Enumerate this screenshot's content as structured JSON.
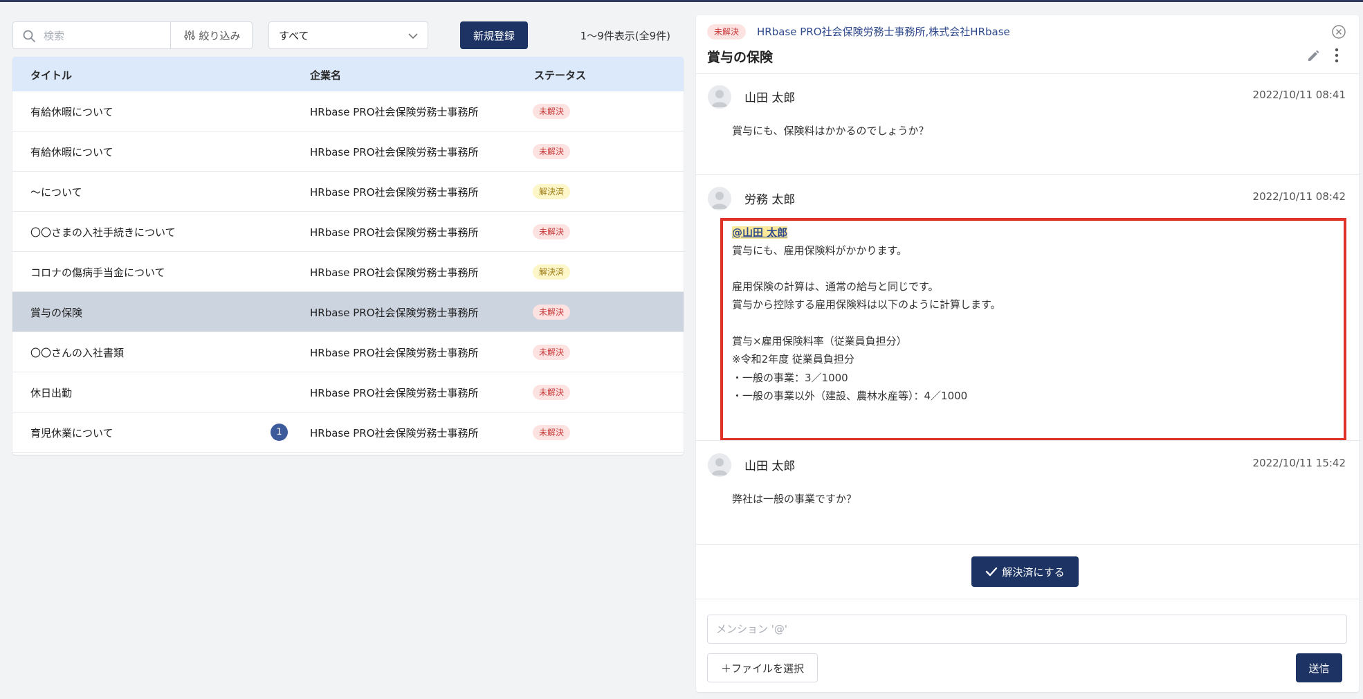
{
  "toolbar": {
    "search_placeholder": "検索",
    "filter_label": "絞り込み",
    "select_value": "すべて",
    "new_button": "新規登録",
    "count": "1～9件表示(全9件)"
  },
  "table": {
    "headers": {
      "title": "タイトル",
      "company": "企業名",
      "status": "ステータス"
    },
    "rows": [
      {
        "title": "有給休暇について",
        "company": "HRbase PRO社会保険労務士事務所",
        "status": "未解決",
        "kind": "unresolved"
      },
      {
        "title": "有給休暇について",
        "company": "HRbase PRO社会保険労務士事務所",
        "status": "未解決",
        "kind": "unresolved"
      },
      {
        "title": "〜について",
        "company": "HRbase PRO社会保険労務士事務所",
        "status": "解決済",
        "kind": "resolved"
      },
      {
        "title": "〇〇さまの入社手続きについて",
        "company": "HRbase PRO社会保険労務士事務所",
        "status": "未解決",
        "kind": "unresolved"
      },
      {
        "title": "コロナの傷病手当金について",
        "company": "HRbase PRO社会保険労務士事務所",
        "status": "解決済",
        "kind": "resolved"
      },
      {
        "title": "賞与の保険",
        "company": "HRbase PRO社会保険労務士事務所",
        "status": "未解決",
        "kind": "unresolved",
        "selected": true
      },
      {
        "title": "〇〇さんの入社書類",
        "company": "HRbase PRO社会保険労務士事務所",
        "status": "未解決",
        "kind": "unresolved"
      },
      {
        "title": "休日出勤",
        "company": "HRbase PRO社会保険労務士事務所",
        "status": "未解決",
        "kind": "unresolved"
      },
      {
        "title": "育児休業について",
        "company": "HRbase PRO社会保険労務士事務所",
        "status": "未解決",
        "kind": "unresolved",
        "unread": "1"
      }
    ]
  },
  "panel": {
    "status": "未解決",
    "company_1": "HRbase PRO社会保険労務士事務所",
    "separator": ",",
    "company_2": "株式会社HRbase",
    "title": "賞与の保険",
    "messages": [
      {
        "author": "山田 太郎",
        "time": "2022/10/11 08:41",
        "lines": [
          "賞与にも、保険料はかかるのでしょうか？"
        ]
      },
      {
        "author": "労務 太郎",
        "time": "2022/10/11 08:42",
        "mention": "@山田 太郎",
        "lines": [
          "賞与にも、雇用保険料がかかります。",
          "",
          "雇用保険の計算は、通常の給与と同じです。",
          "賞与から控除する雇用保険料は以下のように計算します。",
          "",
          "賞与×雇用保険料率（従業員負担分）",
          "※令和2年度 従業員負担分",
          "・一般の事業：3／1000",
          "・一般の事業以外（建設、農林水産等）：4／1000"
        ]
      },
      {
        "author": "山田 太郎",
        "time": "2022/10/11 15:42",
        "lines": [
          "弊社は一般の事業ですか？"
        ]
      }
    ],
    "resolve_button": "解決済にする",
    "mention_placeholder": "メンション '@'",
    "file_button": "＋ファイルを選択",
    "send_button": "送信"
  },
  "colors": {
    "primary": "#1c3363",
    "header_bg": "#dce9fa",
    "selected_row": "#ccd4e0",
    "unresolved_bg": "#fde2e2",
    "unresolved_text": "#c83a3a",
    "resolved_bg": "#fdf6c8",
    "resolved_text": "#9b7a12",
    "highlight_border": "#e03327",
    "mention_bg": "#fbe89a"
  }
}
